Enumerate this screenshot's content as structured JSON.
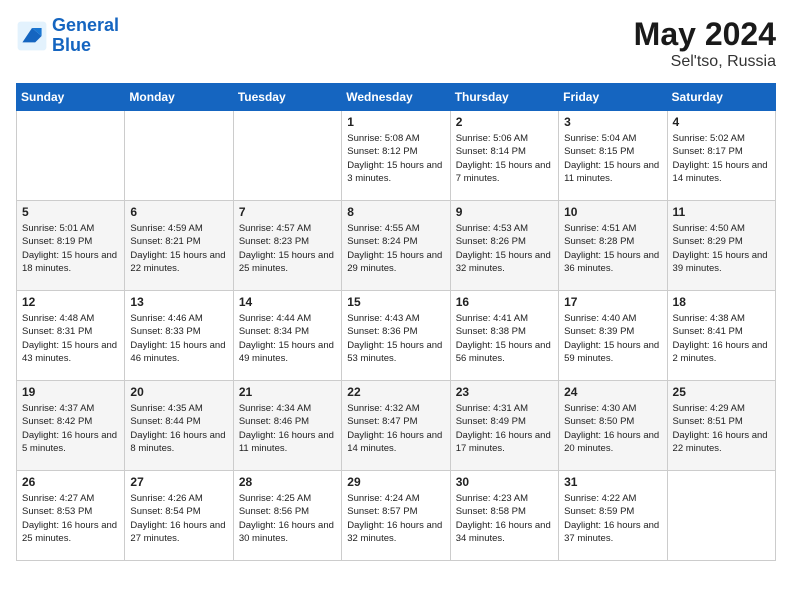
{
  "header": {
    "logo_line1": "General",
    "logo_line2": "Blue",
    "month": "May 2024",
    "location": "Sel'tso, Russia"
  },
  "days_of_week": [
    "Sunday",
    "Monday",
    "Tuesday",
    "Wednesday",
    "Thursday",
    "Friday",
    "Saturday"
  ],
  "weeks": [
    [
      {
        "num": "",
        "info": ""
      },
      {
        "num": "",
        "info": ""
      },
      {
        "num": "",
        "info": ""
      },
      {
        "num": "1",
        "info": "Sunrise: 5:08 AM\nSunset: 8:12 PM\nDaylight: 15 hours\nand 3 minutes."
      },
      {
        "num": "2",
        "info": "Sunrise: 5:06 AM\nSunset: 8:14 PM\nDaylight: 15 hours\nand 7 minutes."
      },
      {
        "num": "3",
        "info": "Sunrise: 5:04 AM\nSunset: 8:15 PM\nDaylight: 15 hours\nand 11 minutes."
      },
      {
        "num": "4",
        "info": "Sunrise: 5:02 AM\nSunset: 8:17 PM\nDaylight: 15 hours\nand 14 minutes."
      }
    ],
    [
      {
        "num": "5",
        "info": "Sunrise: 5:01 AM\nSunset: 8:19 PM\nDaylight: 15 hours\nand 18 minutes."
      },
      {
        "num": "6",
        "info": "Sunrise: 4:59 AM\nSunset: 8:21 PM\nDaylight: 15 hours\nand 22 minutes."
      },
      {
        "num": "7",
        "info": "Sunrise: 4:57 AM\nSunset: 8:23 PM\nDaylight: 15 hours\nand 25 minutes."
      },
      {
        "num": "8",
        "info": "Sunrise: 4:55 AM\nSunset: 8:24 PM\nDaylight: 15 hours\nand 29 minutes."
      },
      {
        "num": "9",
        "info": "Sunrise: 4:53 AM\nSunset: 8:26 PM\nDaylight: 15 hours\nand 32 minutes."
      },
      {
        "num": "10",
        "info": "Sunrise: 4:51 AM\nSunset: 8:28 PM\nDaylight: 15 hours\nand 36 minutes."
      },
      {
        "num": "11",
        "info": "Sunrise: 4:50 AM\nSunset: 8:29 PM\nDaylight: 15 hours\nand 39 minutes."
      }
    ],
    [
      {
        "num": "12",
        "info": "Sunrise: 4:48 AM\nSunset: 8:31 PM\nDaylight: 15 hours\nand 43 minutes."
      },
      {
        "num": "13",
        "info": "Sunrise: 4:46 AM\nSunset: 8:33 PM\nDaylight: 15 hours\nand 46 minutes."
      },
      {
        "num": "14",
        "info": "Sunrise: 4:44 AM\nSunset: 8:34 PM\nDaylight: 15 hours\nand 49 minutes."
      },
      {
        "num": "15",
        "info": "Sunrise: 4:43 AM\nSunset: 8:36 PM\nDaylight: 15 hours\nand 53 minutes."
      },
      {
        "num": "16",
        "info": "Sunrise: 4:41 AM\nSunset: 8:38 PM\nDaylight: 15 hours\nand 56 minutes."
      },
      {
        "num": "17",
        "info": "Sunrise: 4:40 AM\nSunset: 8:39 PM\nDaylight: 15 hours\nand 59 minutes."
      },
      {
        "num": "18",
        "info": "Sunrise: 4:38 AM\nSunset: 8:41 PM\nDaylight: 16 hours\nand 2 minutes."
      }
    ],
    [
      {
        "num": "19",
        "info": "Sunrise: 4:37 AM\nSunset: 8:42 PM\nDaylight: 16 hours\nand 5 minutes."
      },
      {
        "num": "20",
        "info": "Sunrise: 4:35 AM\nSunset: 8:44 PM\nDaylight: 16 hours\nand 8 minutes."
      },
      {
        "num": "21",
        "info": "Sunrise: 4:34 AM\nSunset: 8:46 PM\nDaylight: 16 hours\nand 11 minutes."
      },
      {
        "num": "22",
        "info": "Sunrise: 4:32 AM\nSunset: 8:47 PM\nDaylight: 16 hours\nand 14 minutes."
      },
      {
        "num": "23",
        "info": "Sunrise: 4:31 AM\nSunset: 8:49 PM\nDaylight: 16 hours\nand 17 minutes."
      },
      {
        "num": "24",
        "info": "Sunrise: 4:30 AM\nSunset: 8:50 PM\nDaylight: 16 hours\nand 20 minutes."
      },
      {
        "num": "25",
        "info": "Sunrise: 4:29 AM\nSunset: 8:51 PM\nDaylight: 16 hours\nand 22 minutes."
      }
    ],
    [
      {
        "num": "26",
        "info": "Sunrise: 4:27 AM\nSunset: 8:53 PM\nDaylight: 16 hours\nand 25 minutes."
      },
      {
        "num": "27",
        "info": "Sunrise: 4:26 AM\nSunset: 8:54 PM\nDaylight: 16 hours\nand 27 minutes."
      },
      {
        "num": "28",
        "info": "Sunrise: 4:25 AM\nSunset: 8:56 PM\nDaylight: 16 hours\nand 30 minutes."
      },
      {
        "num": "29",
        "info": "Sunrise: 4:24 AM\nSunset: 8:57 PM\nDaylight: 16 hours\nand 32 minutes."
      },
      {
        "num": "30",
        "info": "Sunrise: 4:23 AM\nSunset: 8:58 PM\nDaylight: 16 hours\nand 34 minutes."
      },
      {
        "num": "31",
        "info": "Sunrise: 4:22 AM\nSunset: 8:59 PM\nDaylight: 16 hours\nand 37 minutes."
      },
      {
        "num": "",
        "info": ""
      }
    ]
  ]
}
